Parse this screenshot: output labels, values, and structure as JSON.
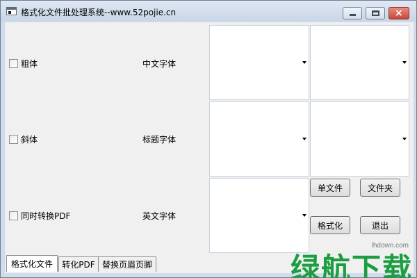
{
  "window": {
    "title": "格式化文件批处理系统--www.52pojie.cn",
    "controls": {
      "minimize": "minimize",
      "maximize": "maximize",
      "close": "×"
    }
  },
  "options": [
    {
      "label": "粗体"
    },
    {
      "label": "斜体"
    },
    {
      "label": "同时转换PDF"
    }
  ],
  "font_labels": {
    "chinese_font": "中文字体",
    "title_font": "标题字体",
    "english_font": "英文字体"
  },
  "buttons": {
    "single_file": "单文件",
    "folder": "文件夹",
    "format": "格式化",
    "exit": "退出"
  },
  "tabs": [
    {
      "label": "格式化文件",
      "active": true
    },
    {
      "label": "转化PDF",
      "active": false
    },
    {
      "label": "替换页眉页脚",
      "active": false
    }
  ],
  "watermark": {
    "url": "lhdown.com",
    "text": "绿航下载"
  }
}
